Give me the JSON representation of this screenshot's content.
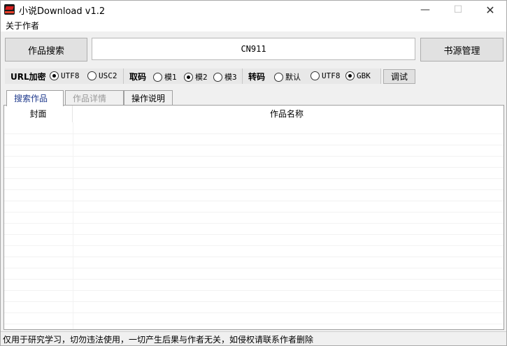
{
  "window": {
    "title": "小说Download v1.2",
    "min_glyph": "—",
    "max_glyph": "☐",
    "close_glyph": "✕"
  },
  "menu": {
    "about": "关于作者"
  },
  "search": {
    "button_label": "作品搜索",
    "input_value": "CN911",
    "source_button_label": "书源管理"
  },
  "options": {
    "url_encode": {
      "label": "URL加密",
      "items": [
        {
          "label": "UTF8",
          "checked": true
        },
        {
          "label": "USC2",
          "checked": false
        }
      ]
    },
    "fetch_mode": {
      "label": "取码",
      "items": [
        {
          "label": "模1",
          "checked": false
        },
        {
          "label": "模2",
          "checked": true
        },
        {
          "label": "模3",
          "checked": false
        }
      ]
    },
    "transcode": {
      "label": "转码",
      "items": [
        {
          "label": "默认",
          "checked": false
        },
        {
          "label": "UTF8",
          "checked": false
        },
        {
          "label": "GBK",
          "checked": true
        }
      ]
    },
    "debug_label": "调试"
  },
  "tabs": [
    {
      "label": "搜索作品"
    },
    {
      "label": "作品详情"
    },
    {
      "label": "操作说明"
    }
  ],
  "table": {
    "columns": [
      "封面",
      "作品名称"
    ]
  },
  "status": {
    "text": "仅用于研究学习，切勿违法使用，一切产生后果与作者无关，如侵权请联系作者删除"
  }
}
